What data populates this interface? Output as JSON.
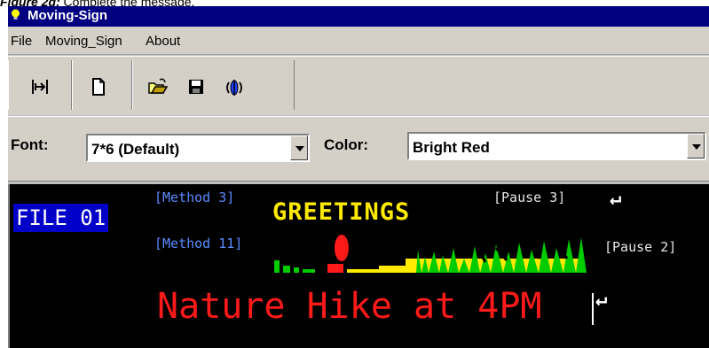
{
  "caption": {
    "label": "Figure 2g:",
    "text": " Complete the message."
  },
  "window": {
    "title": "Moving-Sign"
  },
  "menu": [
    "File",
    "Moving_Sign",
    "About"
  ],
  "toolbar": {
    "icons": [
      "align-icon",
      "new-file-icon",
      "open-folder-icon",
      "save-icon",
      "audio-icon"
    ]
  },
  "font_row": {
    "font_label": "Font:",
    "font_value": "7*6 (Default)",
    "color_label": "Color:",
    "color_value": "Bright Red"
  },
  "editor": {
    "file_tag": "FILE 01",
    "line1": {
      "method": "[Method 3]",
      "text": "GREETINGS",
      "pause": "[Pause  3]"
    },
    "line2": {
      "method": "[Method 11]",
      "pause": "[Pause  2]"
    },
    "line3": {
      "text": "Nature Hike at 4PM"
    },
    "return_symbol": "↵"
  },
  "colors": {
    "title_bar": "#000080",
    "selection": "#0000c8",
    "method_text": "#5a8cff",
    "greet": "#ffea00",
    "hike": "#ff1a1a"
  }
}
